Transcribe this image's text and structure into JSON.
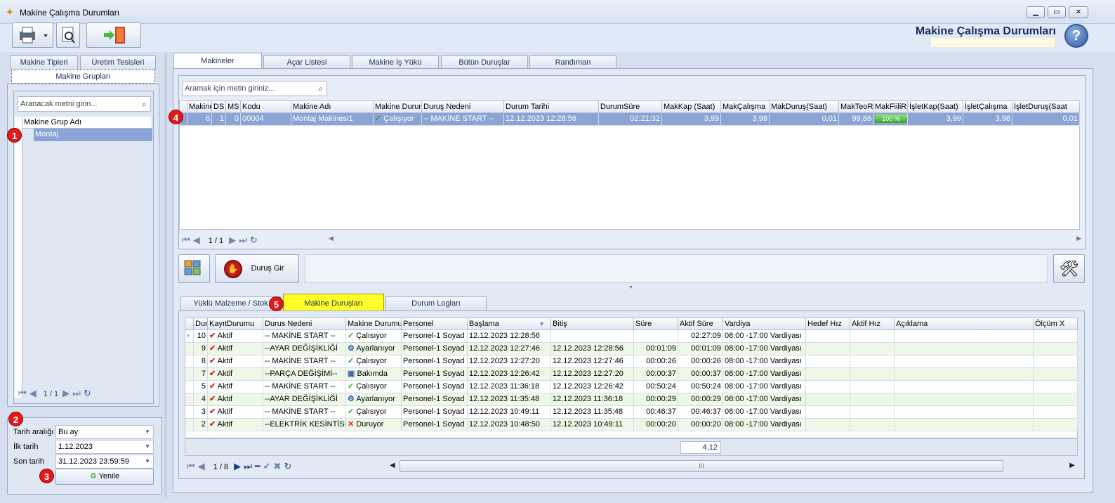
{
  "window": {
    "title": "Makine Çalışma Durumları",
    "header_title": "Makine Çalışma Durumları",
    "help_label": "?"
  },
  "left": {
    "tabs": [
      "Makine Tipleri",
      "Üretim Tesisleri"
    ],
    "group_tab": "Makine Grupları",
    "search_placeholder": "Aranacak metni girin...",
    "col_header": "Makine Grup Adı",
    "rows": [
      "Montaj"
    ],
    "pager": "1 / 1",
    "date_range_label": "Tarih aralığı",
    "date_range_value": "Bu ay",
    "first_date_label": "İlk tarih",
    "first_date_value": "1.12.2023",
    "last_date_label": "Son tarih",
    "last_date_value": "31.12.2023 23:59:59",
    "refresh_label": "Yenile"
  },
  "badges": [
    "1",
    "2",
    "3",
    "4",
    "5"
  ],
  "main_tabs": [
    "Makineler",
    "Açar Listesi",
    "Makine İş Yükü",
    "Bütün Duruşlar",
    "Randıman"
  ],
  "machines": {
    "search_placeholder": "Aramak için metin giriniz...",
    "headers": [
      "Makine",
      "DS",
      "MS",
      "Kodu",
      "Makine Adı",
      "Makine Durum",
      "Duruş Nedeni",
      "Durum Tarihi",
      "DurumSüre",
      "MakKap (Saat)",
      "MakÇalışma",
      "MakDuruş(Saat)",
      "MakTeoRa",
      "MakFiiliRa",
      "İşletKap(Saat)",
      "İşletÇalışma",
      "İşletDuruş(Saat"
    ],
    "row": [
      "6",
      "1",
      "0",
      "00004",
      "Montaj Makinesi1",
      "Çalışıyor",
      "-- MAKİNE START --",
      "12.12.2023 12:28:56",
      "02:21:32",
      "3,99",
      "3,98",
      "0,01",
      "99,86",
      "100 %",
      "3,99",
      "3,98",
      "0,01"
    ],
    "pager": "1 / 1",
    "stop_button": "Duruş Gir"
  },
  "bottom_tabs": [
    "Yüklü Malzeme / Stok",
    "Makine Duruşları",
    "Durum Logları"
  ],
  "stops": {
    "headers": [
      "Dur",
      "KayıtDurumu",
      "Durus Nedeni",
      "Makine Durumu",
      "Personel",
      "Başlama",
      "Bitiş",
      "Süre",
      "Aktif Süre",
      "Vardiya",
      "Hedef Hız",
      "Aktif Hız",
      "Açıklama",
      "Ölçüm X"
    ],
    "rows": [
      [
        "10",
        "Aktif",
        "-- MAKİNE START --",
        "Çalısıyor",
        "Personel-1 Soyad",
        "12.12.2023 12:28:56",
        "",
        "",
        "02:27:09",
        "08:00 -17:00 Vardiyası"
      ],
      [
        "9",
        "Aktif",
        "--AYAR DEĞİŞİKLİĞİ",
        "Ayarlanıyor",
        "Personel-1 Soyad",
        "12.12.2023 12:27:46",
        "12.12.2023 12:28:56",
        "00:01:09",
        "00:01:09",
        "08:00 -17:00 Vardiyası"
      ],
      [
        "8",
        "Aktif",
        "-- MAKİNE START --",
        "Çalısıyor",
        "Personel-1 Soyad",
        "12.12.2023 12:27:20",
        "12.12.2023 12:27:46",
        "00:00:26",
        "00:00:26",
        "08:00 -17:00 Vardiyası"
      ],
      [
        "7",
        "Aktif",
        "--PARÇA DEĞİŞİMİ--",
        "Bakımda",
        "Personel-1 Soyad",
        "12.12.2023 12:26:42",
        "12.12.2023 12:27:20",
        "00:00:37",
        "00:00:37",
        "08:00 -17:00 Vardiyası"
      ],
      [
        "5",
        "Aktif",
        "-- MAKİNE START --",
        "Çalısıyor",
        "Personel-1 Soyad",
        "12.12.2023 11:36:18",
        "12.12.2023 12:26:42",
        "00:50:24",
        "00:50:24",
        "08:00 -17:00 Vardiyası"
      ],
      [
        "4",
        "Aktif",
        "--AYAR DEĞİŞİKLİĞİ",
        "Ayarlanıyor",
        "Personel-1 Soyad",
        "12.12.2023 11:35:48",
        "12.12.2023 11:36:18",
        "00:00:29",
        "00:00:29",
        "08:00 -17:00 Vardiyası"
      ],
      [
        "3",
        "Aktif",
        "-- MAKİNE START --",
        "Çalısıyor",
        "Personel-1 Soyad",
        "12.12.2023 10:49:11",
        "12.12.2023 11:35:48",
        "00:46:37",
        "00:46:37",
        "08:00 -17:00 Vardiyası"
      ],
      [
        "2",
        "Aktif",
        "--ELEKTRİK KESİNTİSİ--",
        "Duruyor",
        "Personel-1 Soyad",
        "12.12.2023 10:48:50",
        "12.12.2023 10:49:11",
        "00:00:20",
        "00:00:20",
        "08:00 -17:00 Vardiyası"
      ]
    ],
    "status_icons": [
      "check-icon",
      "wrench-icon",
      "check-icon",
      "maintenance-icon",
      "check-icon",
      "wrench-icon",
      "check-icon",
      "cross-icon"
    ],
    "summary": "4,12",
    "pager": "1 / 8",
    "scroll_grip": "III"
  }
}
